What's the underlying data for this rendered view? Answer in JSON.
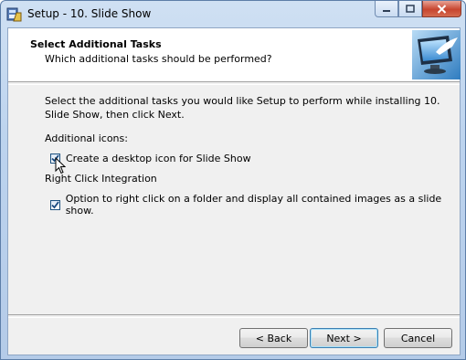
{
  "window": {
    "title": "Setup - 10. Slide Show"
  },
  "header": {
    "title": "Select Additional Tasks",
    "subtitle": "Which additional tasks should be performed?"
  },
  "body": {
    "description": "Select the additional tasks you would like Setup to perform while installing 10. Slide Show, then click Next.",
    "group1_label": "Additional icons:",
    "task1": {
      "label": "Create a desktop icon for Slide Show",
      "checked": true
    },
    "group2_label": "Right Click Integration",
    "task2": {
      "label": "Option to right click on a folder and display all contained images as a slide show.",
      "checked": true
    }
  },
  "buttons": {
    "back": "< Back",
    "next": "Next >",
    "cancel": "Cancel"
  },
  "colors": {
    "checkmark": "#1a4a80",
    "title_bar": "#bcd3ee",
    "close_button": "#c7452f"
  }
}
